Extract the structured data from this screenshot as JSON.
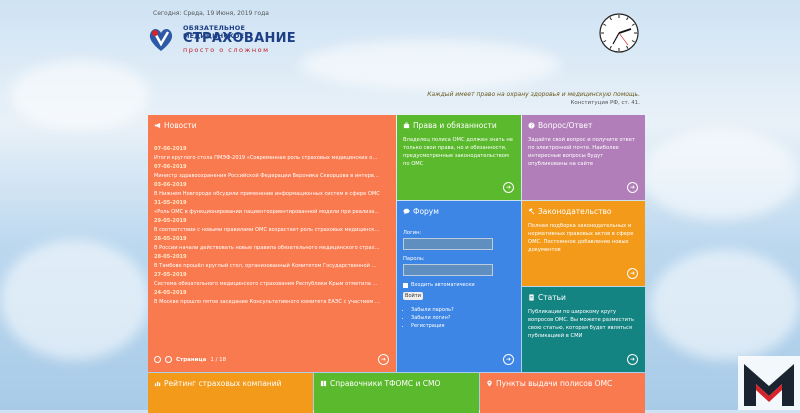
{
  "header": {
    "date": "Сегодня: Среда, 19 Июня, 2019 года",
    "logo_line1": "ОБЯЗАТЕЛЬНОЕ МЕДИЦИНСКОЕ",
    "logo_line2": "СТРАХОВАНИЕ",
    "logo_line3": "просто о сложном"
  },
  "quote": {
    "text": "Каждый имеет право на охрану здоровья и медицинскую помощь.",
    "source": "Конституция РФ, ст. 41."
  },
  "news": {
    "title": "Новости",
    "items": [
      {
        "date": "07-06-2019",
        "text": "Итоги круглого стола ПМЭФ-2019 «Современная роль страховых медицинских организ..."
      },
      {
        "date": "07-06-2019",
        "text": "Министр здравоохранения Российской Федерации Вероника Скворцова в интервью «Ро..."
      },
      {
        "date": "03-06-2019",
        "text": "В Нижнем Новгороде обсудили применение информационных систем в сфере ОМС"
      },
      {
        "date": "31-05-2019",
        "text": "«Роль ОМС в функционировании пациентоориентированной модели при реализации нац..."
      },
      {
        "date": "29-05-2019",
        "text": "В соответствии с новыми правилами ОМС возрастает роль страховых медицинских ор..."
      },
      {
        "date": "28-05-2019",
        "text": "В России начали действовать новые правила обязательного медицинского страхова..."
      },
      {
        "date": "28-05-2019",
        "text": "В Тамбове прошёл круглый стол, организованный Комитетом Государственной Думы п..."
      },
      {
        "date": "27-05-2019",
        "text": "Система обязательного медицинского страхования Республики Крым отметила пятиле..."
      },
      {
        "date": "24-05-2019",
        "text": "В Москве прошло пятое заседание Консультативного комитета ЕАЭС с участием пред..."
      }
    ],
    "pager_label": "Страница",
    "pager_value": "1 / 18"
  },
  "rights": {
    "title": "Права и обязанности",
    "text": "Владелец полиса ОМС должен знать не только свои права, но и обязанности, предусмотренные законодательством по ОМС"
  },
  "qa": {
    "title": "Вопрос/Ответ",
    "text": "Задайте свой вопрос и получите ответ по электронной почте. Наиболее интересные вопросы будут опубликованы на сайте"
  },
  "forum": {
    "title": "Форум",
    "login_label": "Логин:",
    "password_label": "Пароль:",
    "remember_label": "Входить автоматически",
    "submit_label": "Войти",
    "links": [
      "Забыли пароль?",
      "Забыли логин?",
      "Регистрация"
    ]
  },
  "law": {
    "title": "Законодательство",
    "text": "Полная подборка законодательных и нормативных правовых актов в сфере ОМС. Постоянное добавление новых документов"
  },
  "articles": {
    "title": "Статьи",
    "text": "Публикации по широкому кругу вопросов ОМС. Вы можете разместить свою статью, которая будет являться публикацией в СМИ"
  },
  "bottom": {
    "rating_title": "Рейтинг страховых компаний",
    "refs_title": "Справочники ТФОМС и СМО",
    "points_title": "Пункты выдачи полисов ОМС"
  },
  "colors": {
    "orange": "#fa7a50",
    "green": "#5ab92c",
    "purple": "#b17eb9",
    "blue": "#3d86e6",
    "amber": "#f39a1a",
    "teal": "#148483"
  }
}
